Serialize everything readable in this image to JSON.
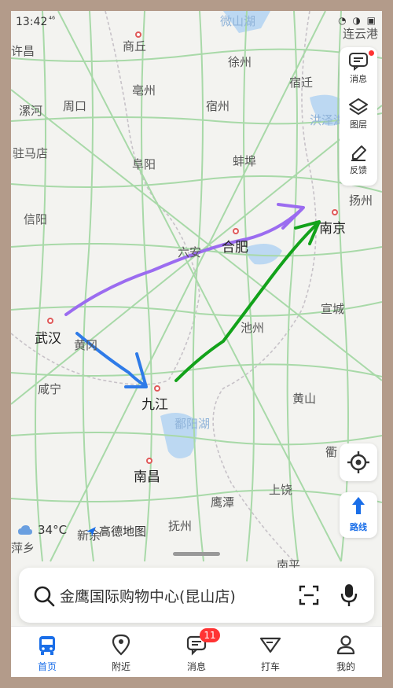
{
  "status_bar": {
    "time": "13:42",
    "network": "⁴⁶",
    "right_icons": "◔ ◑ ▣"
  },
  "map_labels": {
    "lianyungang": "连云港",
    "weishanhu": "微山湖",
    "xuchang": "许昌",
    "shangqiu": "商丘",
    "xuzhou": "徐州",
    "suqian": "宿迁",
    "bozhou": "亳州",
    "luohe": "漯河",
    "zhoukou": "周口",
    "suzhou_ah": "宿州",
    "hongzehu": "洪泽湖",
    "zhumadian": "驻马店",
    "fuyang": "阜阳",
    "bengbu": "蚌埠",
    "yangzhou": "扬州",
    "xinyang": "信阳",
    "nanjing": "南京",
    "luan": "六安",
    "hefei": "合肥",
    "xuancheng": "宣城",
    "wuhan": "武汉",
    "huanggang": "黄冈",
    "chizhou": "池州",
    "xianning": "咸宁",
    "huangshan": "黄山",
    "jiujiang": "九江",
    "poyanghu": "鄱阳湖",
    "quzhou": "衢",
    "nanchang": "南昌",
    "shangrao": "上饶",
    "yingtan": "鹰潭",
    "fuzhou_jx": "抚州",
    "xinyu": "新余",
    "pingxiang": "萍乡",
    "nanping": "南平"
  },
  "side_panel": {
    "messages": "消息",
    "layers": "图层",
    "feedback": "反馈"
  },
  "route_button": "路线",
  "weather": {
    "temp": "34°C"
  },
  "brand": "高德地图",
  "search": {
    "query": "金鹰国际购物中心(昆山店)"
  },
  "tabs": [
    {
      "label": "首页"
    },
    {
      "label": "附近"
    },
    {
      "label": "消息",
      "badge": "11"
    },
    {
      "label": "打车"
    },
    {
      "label": "我的"
    }
  ],
  "colors": {
    "accent": "#1a6ee8",
    "road": "#a8d9a8",
    "water": "#bcd8f2",
    "arrow_purple": "#9b6cf0",
    "arrow_blue": "#2f7be8",
    "arrow_green": "#12a21a"
  }
}
